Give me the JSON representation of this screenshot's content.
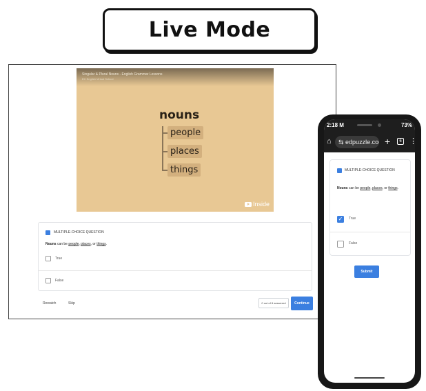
{
  "banner": {
    "title": "Live Mode"
  },
  "desktop": {
    "video": {
      "title": "Singular & Plural Nouns - English Grammar Lessons",
      "channel": "EC English Virtual School",
      "heading": "nouns",
      "items": [
        "people",
        "places",
        "things"
      ],
      "watermark": "Inside"
    },
    "question": {
      "type_label": "MULTIPLE-CHOICE QUESTION",
      "text_bold": "Nouns",
      "text_1": " can be ",
      "text_people": "people",
      "text_2": ", ",
      "text_places": "places",
      "text_3": ", or ",
      "text_things": "things",
      "text_4": ".",
      "options": [
        {
          "label": "True",
          "checked": false
        },
        {
          "label": "False",
          "checked": false
        }
      ]
    },
    "footer": {
      "rewatch": "Rewatch",
      "skip": "Skip",
      "answered": "0 out of 8 answered",
      "continue": "Continue"
    }
  },
  "phone": {
    "status": {
      "time": "2:18 M",
      "battery": "73%"
    },
    "browser": {
      "home_glyph": "⌂",
      "url": "⇆ edpuzzle.com/",
      "plus": "+",
      "tabs_count": "6",
      "menu": "⋮"
    },
    "question": {
      "type_label": "MULTIPLE-CHOICE QUESTION",
      "text_bold": "Nouns",
      "text_1": " can be ",
      "text_people": "people",
      "text_2": ", ",
      "text_places": "places",
      "text_3": ", or ",
      "text_things": "things",
      "text_4": ".",
      "options": [
        {
          "label": "True",
          "checked": true,
          "mark": "✓"
        },
        {
          "label": "False",
          "checked": false,
          "mark": ""
        }
      ]
    },
    "submit": "Submit"
  },
  "colors": {
    "accent": "#3b7fe0",
    "video_bg": "#e8c894",
    "tag_bg": "#d3b07e",
    "phone_frame": "#171717"
  }
}
